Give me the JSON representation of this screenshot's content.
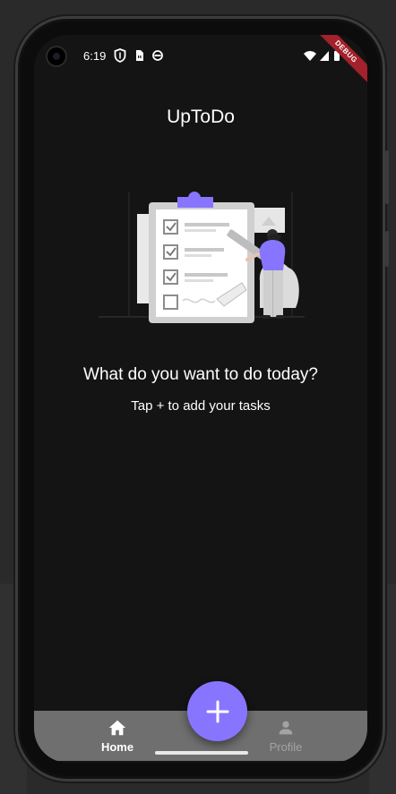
{
  "status_bar": {
    "time": "6:19",
    "left_icons": [
      "shield-icon",
      "sim-card-icon",
      "app-notification-icon"
    ],
    "right_icons": [
      "wifi-icon",
      "signal-icon",
      "battery-icon"
    ],
    "debug_banner": "DEBUG"
  },
  "app": {
    "title": "UpToDo"
  },
  "empty_state": {
    "headline": "What do you want to do today?",
    "subline": "Tap + to add your tasks",
    "illustration": "checklist-illustration"
  },
  "bottom_nav": {
    "items": [
      {
        "label": "Home",
        "icon": "home-icon",
        "active": true
      },
      {
        "label": "Profile",
        "icon": "person-icon",
        "active": false
      }
    ]
  },
  "fab": {
    "icon": "plus-icon"
  },
  "colors": {
    "accent": "#8875FF",
    "background": "#141414",
    "nav_background": "#6F6F6F",
    "debug_ribbon": "#A3212A"
  }
}
